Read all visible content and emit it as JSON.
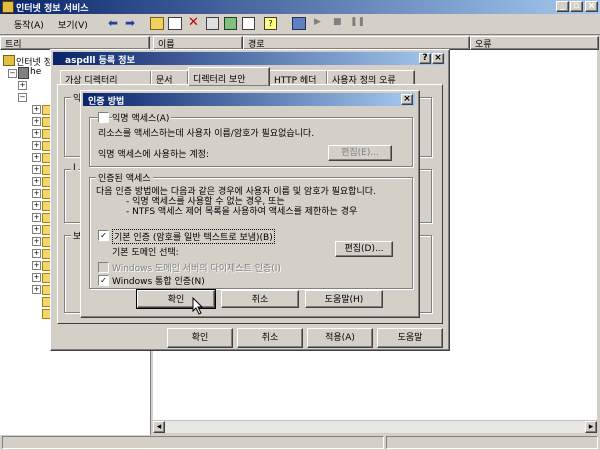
{
  "main_window": {
    "title": "인터넷 정보 서비스",
    "menu": {
      "action": "동작(A)",
      "view": "보기(V)"
    },
    "columns": {
      "tree": "트리",
      "name": "이름",
      "path": "경로",
      "error": "오류"
    },
    "tree_root": "인터넷 정",
    "tree_item": "he"
  },
  "props_dialog": {
    "title": "aspdll 등록 정보",
    "tabs": [
      "가상 디렉터리",
      "문서",
      "디렉터리 보안",
      "HTTP 헤더",
      "사용자 정의 오류"
    ],
    "active_tab": 2,
    "buttons": {
      "ok": "확인",
      "cancel": "취소",
      "apply": "적용(A)",
      "help": "도움말"
    }
  },
  "auth_dialog": {
    "title": "인증 방법",
    "anonymous": {
      "label": "익명 액세스(A)",
      "checked": false,
      "desc": "리소스를 액세스하는데 사용자 이름/암호가 필요없습니다.",
      "account_label": "익명 액세스에 사용하는 계정:",
      "edit_button": "편집(E)..."
    },
    "authenticated": {
      "legend": "인증된 액세스",
      "desc_line1": "다음 인증 방법에는 다음과 같은 경우에 사용자 이름 및 암호가 필요합니다.",
      "desc_line2": "- 익명 액세스를 사용할 수 없는 경우, 또는",
      "desc_line3": "- NTFS 액세스 제어 목록을 사용하여 액세스를 제한하는 경우",
      "basic_label": "기본 인증 (암호를 일반 텍스트로 보냄)(B)",
      "basic_checked": true,
      "domain_label": "기본 도메인 선택:",
      "domain_edit": "편집(D)...",
      "digest_label": "Windows 도메인 서버의 다이제스트 인증(I)",
      "digest_checked": false,
      "windows_label": "Windows 통합 인증(N)",
      "windows_checked": true
    },
    "buttons": {
      "ok": "확인",
      "cancel": "취소",
      "help": "도움말(H)"
    }
  },
  "bg_letters": {
    "a": "익",
    "b": "I",
    "c": "보"
  }
}
